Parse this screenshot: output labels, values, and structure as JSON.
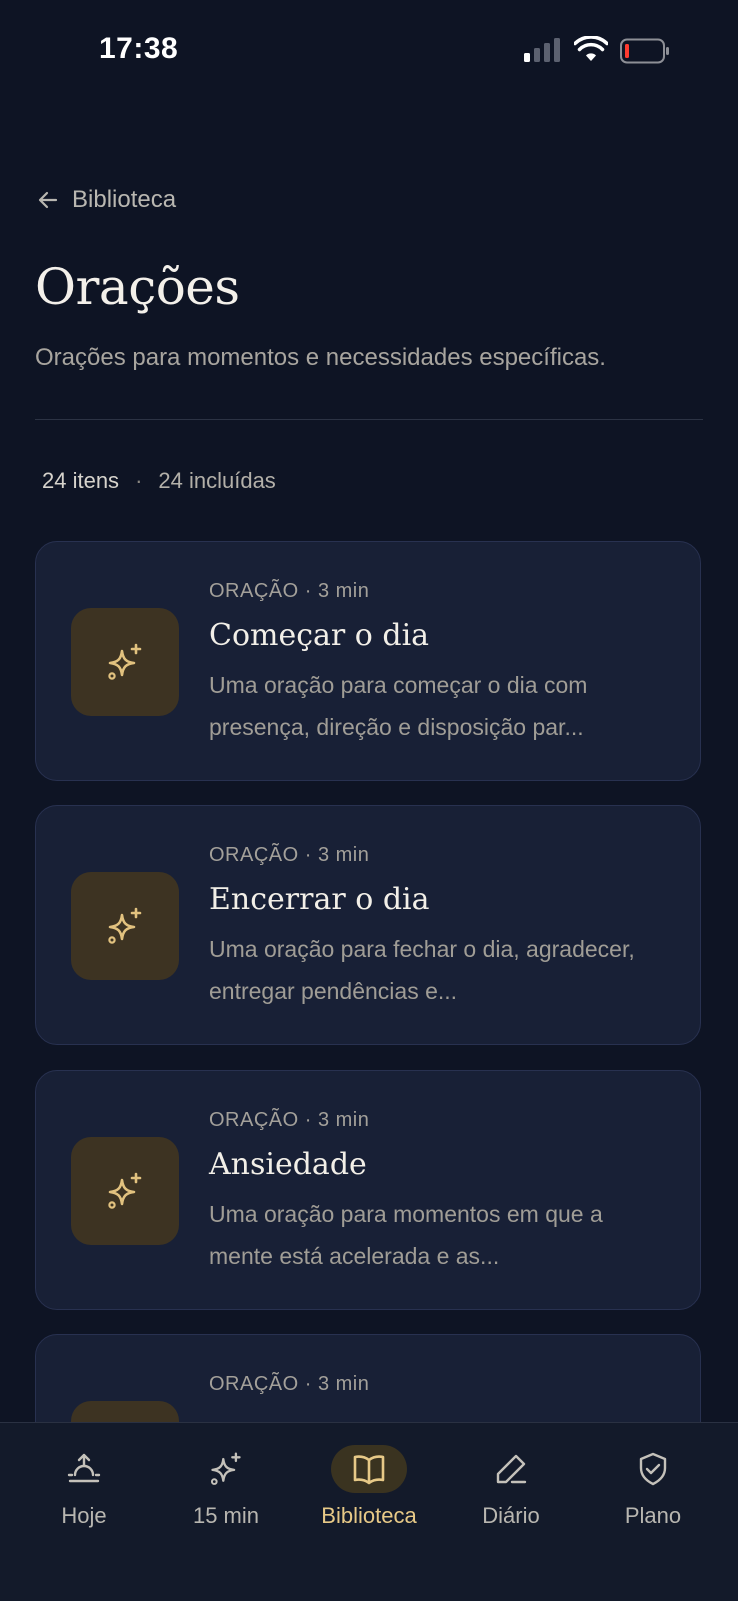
{
  "status_bar": {
    "time": "17:38"
  },
  "header": {
    "back_label": "Biblioteca",
    "title": "Orações",
    "subtitle": "Orações para momentos e necessidades específicas."
  },
  "meta": {
    "count": "24 itens",
    "separator": "·",
    "included": "24 incluídas"
  },
  "items": [
    {
      "kicker": "ORAÇÃO · 3 min",
      "title": "Começar o dia",
      "description": "Uma oração para começar o dia com presença, direção e disposição par..."
    },
    {
      "kicker": "ORAÇÃO · 3 min",
      "title": "Encerrar o dia",
      "description": "Uma oração para fechar o dia, agradecer, entregar pendências e..."
    },
    {
      "kicker": "ORAÇÃO · 3 min",
      "title": "Ansiedade",
      "description": "Uma oração para momentos em que a mente está acelerada e as..."
    },
    {
      "kicker": "ORAÇÃO · 3 min",
      "title": "",
      "description": ""
    }
  ],
  "tabs": [
    {
      "label": "Hoje",
      "icon": "sunrise-icon"
    },
    {
      "label": "15 min",
      "icon": "sparkles-icon"
    },
    {
      "label": "Biblioteca",
      "icon": "open-book-icon",
      "active": true
    },
    {
      "label": "Diário",
      "icon": "pencil-icon"
    },
    {
      "label": "Plano",
      "icon": "shield-check-icon"
    }
  ],
  "colors": {
    "background": "#0e1424",
    "card": "#182036",
    "accent": "#e7c987",
    "icon_tile": "#3d3322"
  }
}
